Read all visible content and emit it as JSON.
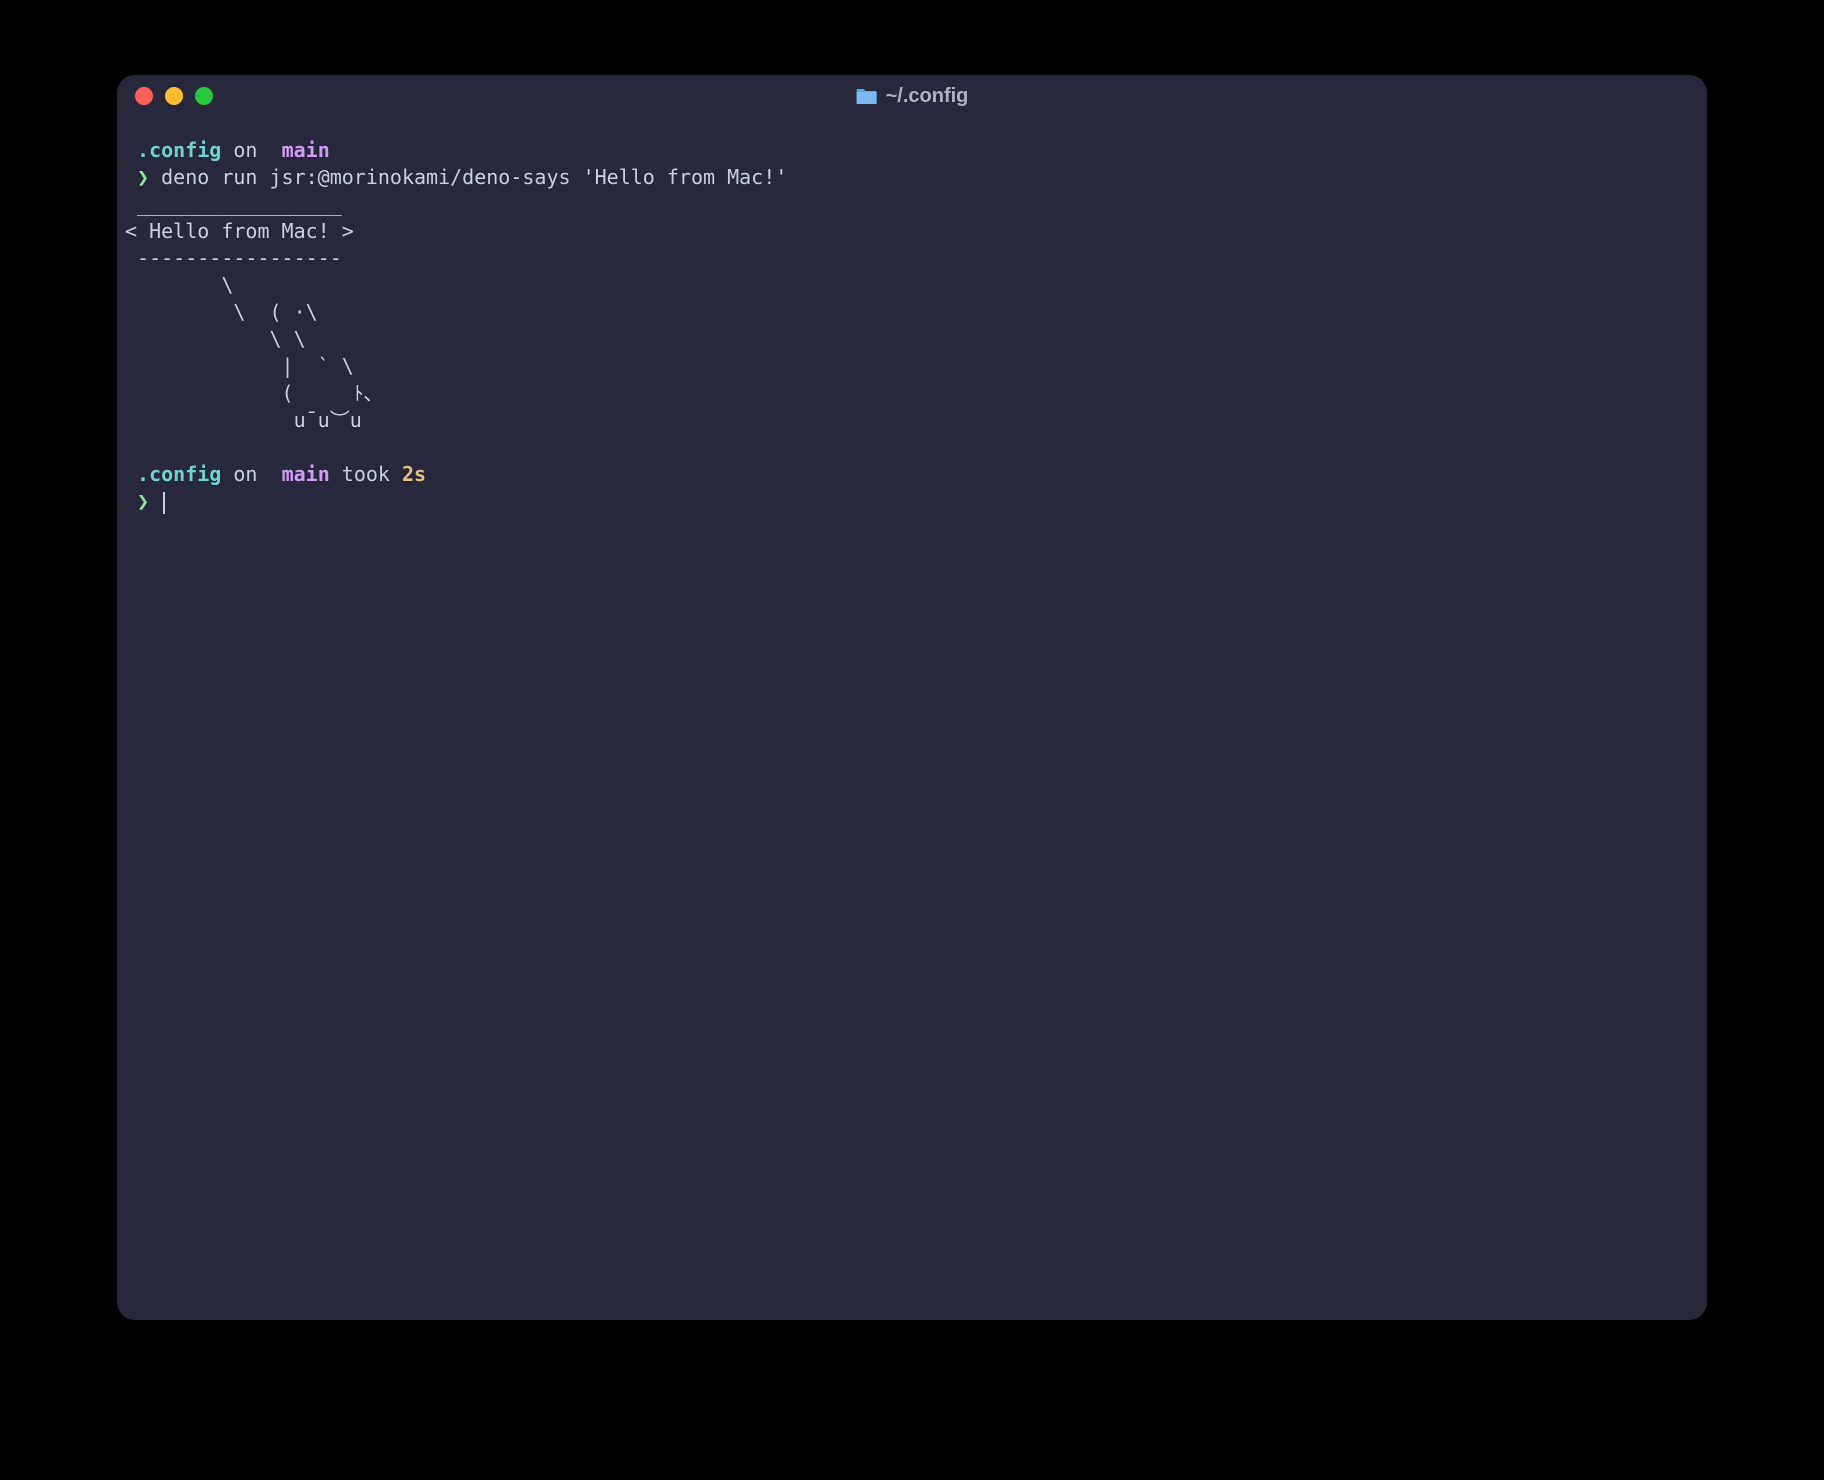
{
  "window": {
    "title": "~/.config"
  },
  "prompt1": {
    "path": ".config",
    "on": "on",
    "git_glyph": "",
    "branch": "main",
    "chevron": "❯",
    "command": "deno run jsr:@morinokami/deno-says 'Hello from Mac!'"
  },
  "output": {
    "line1": " _________________",
    "line2": "< Hello from Mac! >",
    "line3": " -----------------",
    "line4": "        \\",
    "line5": "         \\  ( ·\\",
    "line6": "            \\ \\",
    "line7": "             |  ` \\",
    "line8": "             (     ﾄ､",
    "line9": "              u¯u︶u"
  },
  "prompt2": {
    "path": ".config",
    "on": "on",
    "git_glyph": "",
    "branch": "main",
    "took": "took",
    "duration": "2s",
    "chevron": "❯"
  }
}
